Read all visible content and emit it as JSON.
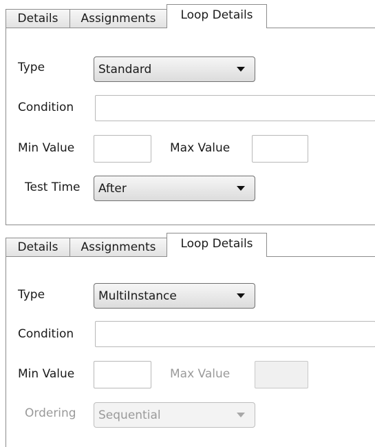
{
  "panels": [
    {
      "tabs": [
        "Details",
        "Assignments",
        "Loop Details"
      ],
      "active_tab": "Loop Details",
      "type": {
        "label": "Type",
        "value": "Standard"
      },
      "condition": {
        "label": "Condition",
        "value": ""
      },
      "min_value": {
        "label": "Min Value",
        "value": ""
      },
      "max_value": {
        "label": "Max Value",
        "value": "",
        "enabled": true
      },
      "fourth": {
        "label": "Test Time",
        "value": "After",
        "enabled": true
      }
    },
    {
      "tabs": [
        "Details",
        "Assignments",
        "Loop Details"
      ],
      "active_tab": "Loop Details",
      "type": {
        "label": "Type",
        "value": "MultiInstance"
      },
      "condition": {
        "label": "Condition",
        "value": ""
      },
      "min_value": {
        "label": "Min Value",
        "value": ""
      },
      "max_value": {
        "label": "Max Value",
        "value": "",
        "enabled": false
      },
      "fourth": {
        "label": "Ordering",
        "value": "Sequential",
        "enabled": false
      }
    }
  ],
  "icons": {
    "dropdown": "chevron-down-icon"
  }
}
